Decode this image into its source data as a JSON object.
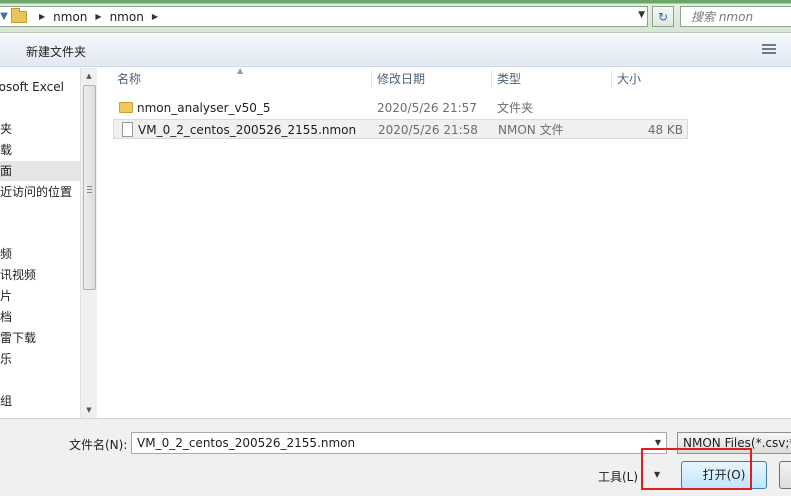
{
  "address_bar": {
    "crumbs": [
      "nmon",
      "nmon"
    ],
    "refresh_icon": "refresh-icon"
  },
  "search": {
    "placeholder": "搜索 nmon"
  },
  "toolbar": {
    "new_folder_label": "新建文件夹"
  },
  "nav": {
    "items": [
      {
        "label": "rosoft Excel"
      },
      {
        "label": "藏夹"
      },
      {
        "label": "下载"
      },
      {
        "label": "桌面",
        "selected": true
      },
      {
        "label": "最近访问的位置"
      },
      {
        "label": "视频"
      },
      {
        "label": "腾讯视频"
      },
      {
        "label": "图片"
      },
      {
        "label": "文档"
      },
      {
        "label": "迅雷下载"
      },
      {
        "label": "音乐"
      },
      {
        "label": "庭组"
      }
    ]
  },
  "columns": {
    "name": "名称",
    "date": "修改日期",
    "type": "类型",
    "size": "大小"
  },
  "files": [
    {
      "icon": "folder-icon",
      "name": "nmon_analyser_v50_5",
      "date": "2020/5/26 21:57",
      "type": "文件夹",
      "size": ""
    },
    {
      "icon": "file-icon",
      "name": "VM_0_2_centos_200526_2155.nmon",
      "date": "2020/5/26 21:58",
      "type": "NMON 文件",
      "size": "48 KB",
      "selected": true
    }
  ],
  "footer": {
    "filename_label": "文件名(N):",
    "filename_value": "VM_0_2_centos_200526_2155.nmon",
    "filter_value": "NMON Files(*.csv;*",
    "tools_label": "工具(L)",
    "open_label": "打开(O)"
  },
  "colors": {
    "highlight_box": "#e02020",
    "open_button_border": "#3c7fb1"
  }
}
